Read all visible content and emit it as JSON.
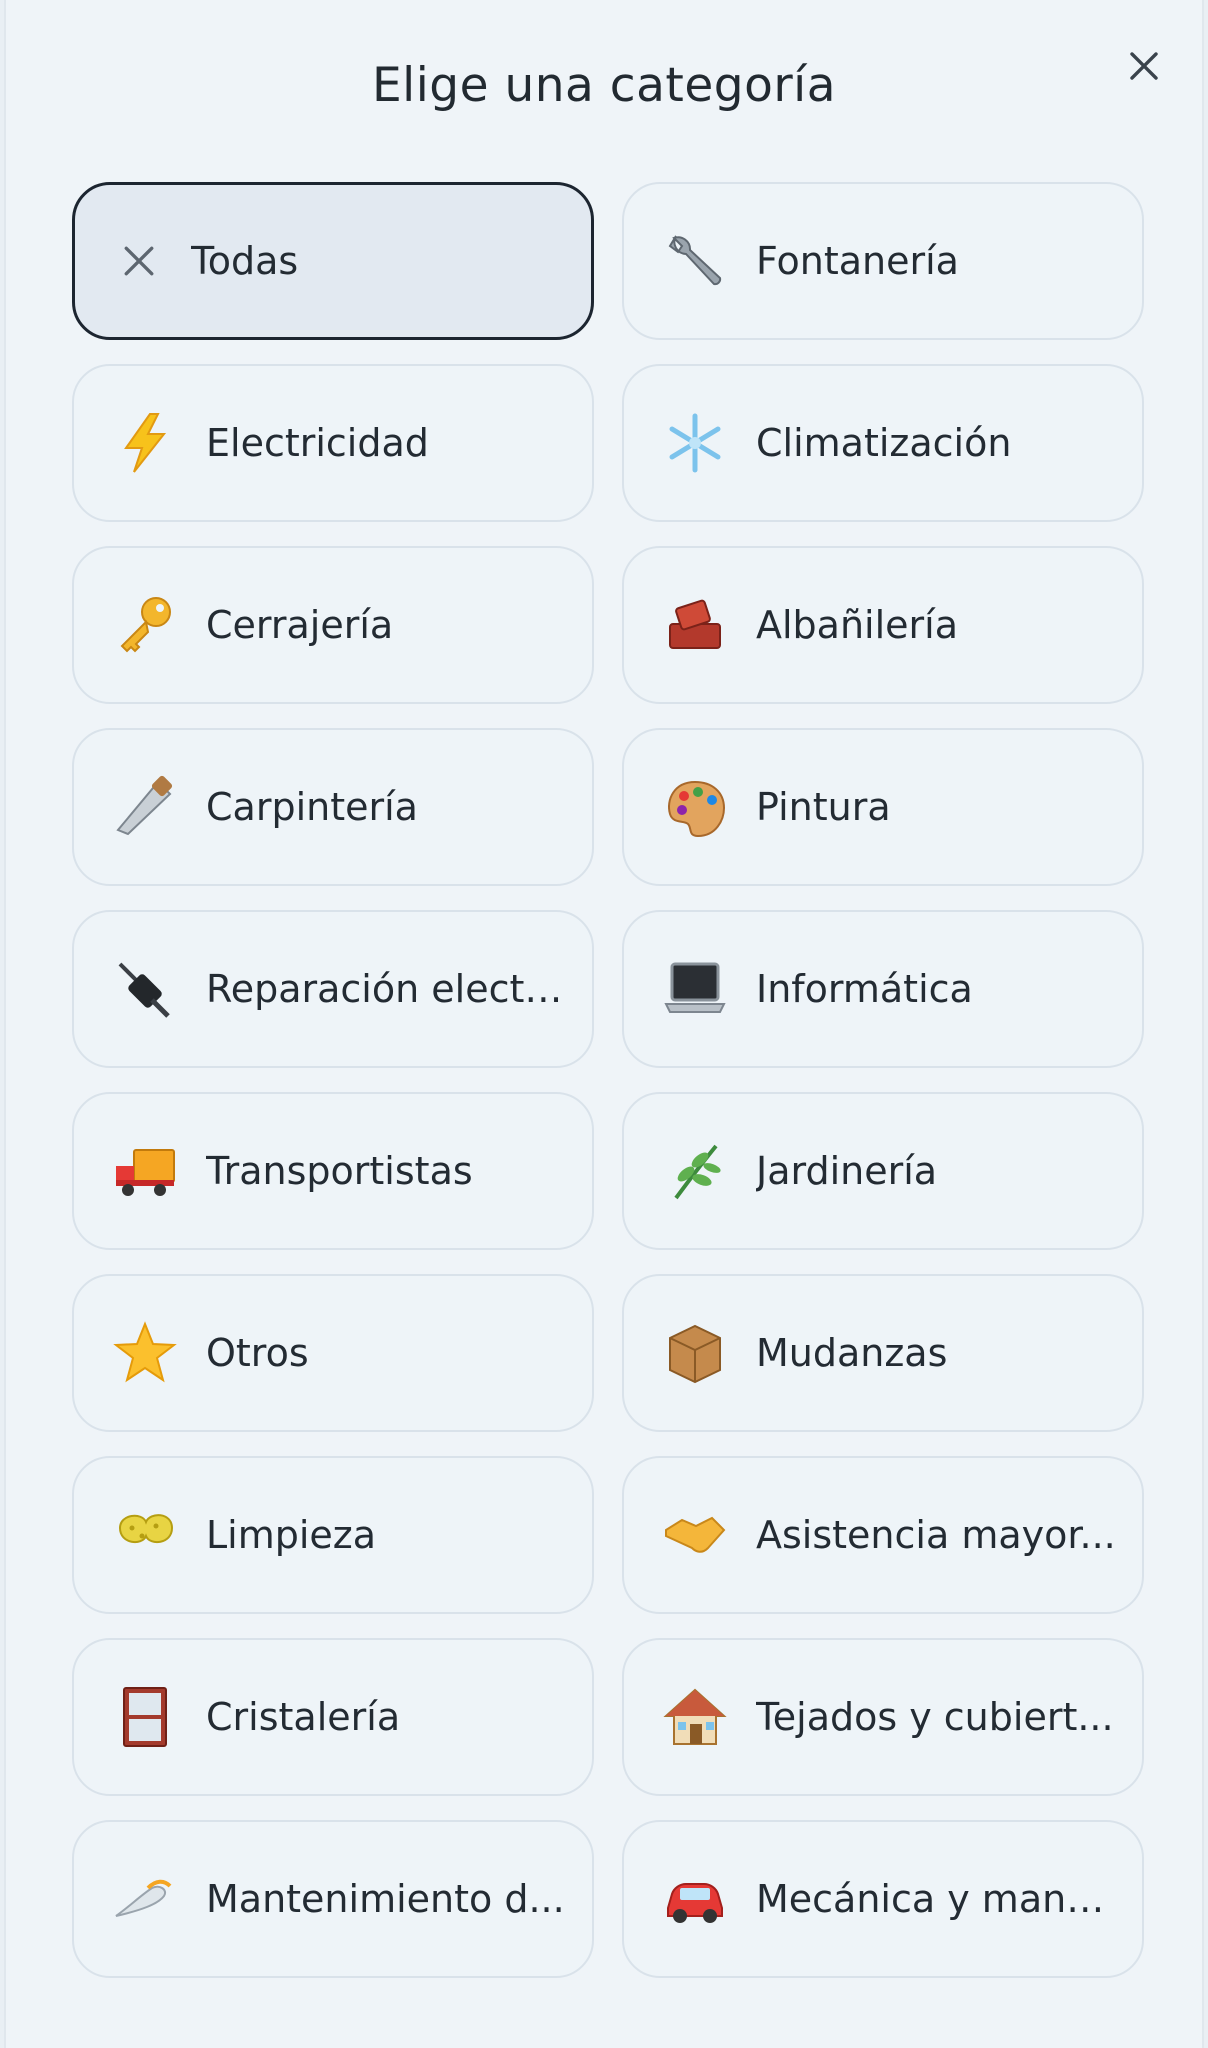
{
  "header": {
    "title": "Elige una categoría",
    "close_icon": "close-icon"
  },
  "categories": [
    {
      "label": "Todas",
      "icon": "x-icon",
      "selected": true
    },
    {
      "label": "Fontanería",
      "icon": "wrench-icon",
      "selected": false
    },
    {
      "label": "Electricidad",
      "icon": "lightning-icon",
      "selected": false
    },
    {
      "label": "Climatización",
      "icon": "snowflake-icon",
      "selected": false
    },
    {
      "label": "Cerrajería",
      "icon": "key-icon",
      "selected": false
    },
    {
      "label": "Albañilería",
      "icon": "bricks-icon",
      "selected": false
    },
    {
      "label": "Carpintería",
      "icon": "saw-icon",
      "selected": false
    },
    {
      "label": "Pintura",
      "icon": "palette-icon",
      "selected": false
    },
    {
      "label": "Reparación electr...",
      "icon": "plug-icon",
      "selected": false
    },
    {
      "label": "Informática",
      "icon": "laptop-icon",
      "selected": false
    },
    {
      "label": "Transportistas",
      "icon": "truck-icon",
      "selected": false
    },
    {
      "label": "Jardinería",
      "icon": "herb-icon",
      "selected": false
    },
    {
      "label": "Otros",
      "icon": "star-icon",
      "selected": false
    },
    {
      "label": "Mudanzas",
      "icon": "package-icon",
      "selected": false
    },
    {
      "label": "Limpieza",
      "icon": "sponge-icon",
      "selected": false
    },
    {
      "label": "Asistencia mayor...",
      "icon": "handshake-icon",
      "selected": false
    },
    {
      "label": "Cristalería",
      "icon": "window-icon",
      "selected": false
    },
    {
      "label": "Tejados y cubiert...",
      "icon": "house-icon",
      "selected": false
    },
    {
      "label": "Mantenimiento d...",
      "icon": "wave-icon",
      "selected": false
    },
    {
      "label": "Mecánica y mant...",
      "icon": "car-icon",
      "selected": false
    }
  ],
  "colors": {
    "background": "#eff4f8",
    "card_border": "#d9e2ea",
    "selected_border": "#1c2530",
    "selected_fill": "#e2e9f1",
    "text": "#232b33"
  }
}
